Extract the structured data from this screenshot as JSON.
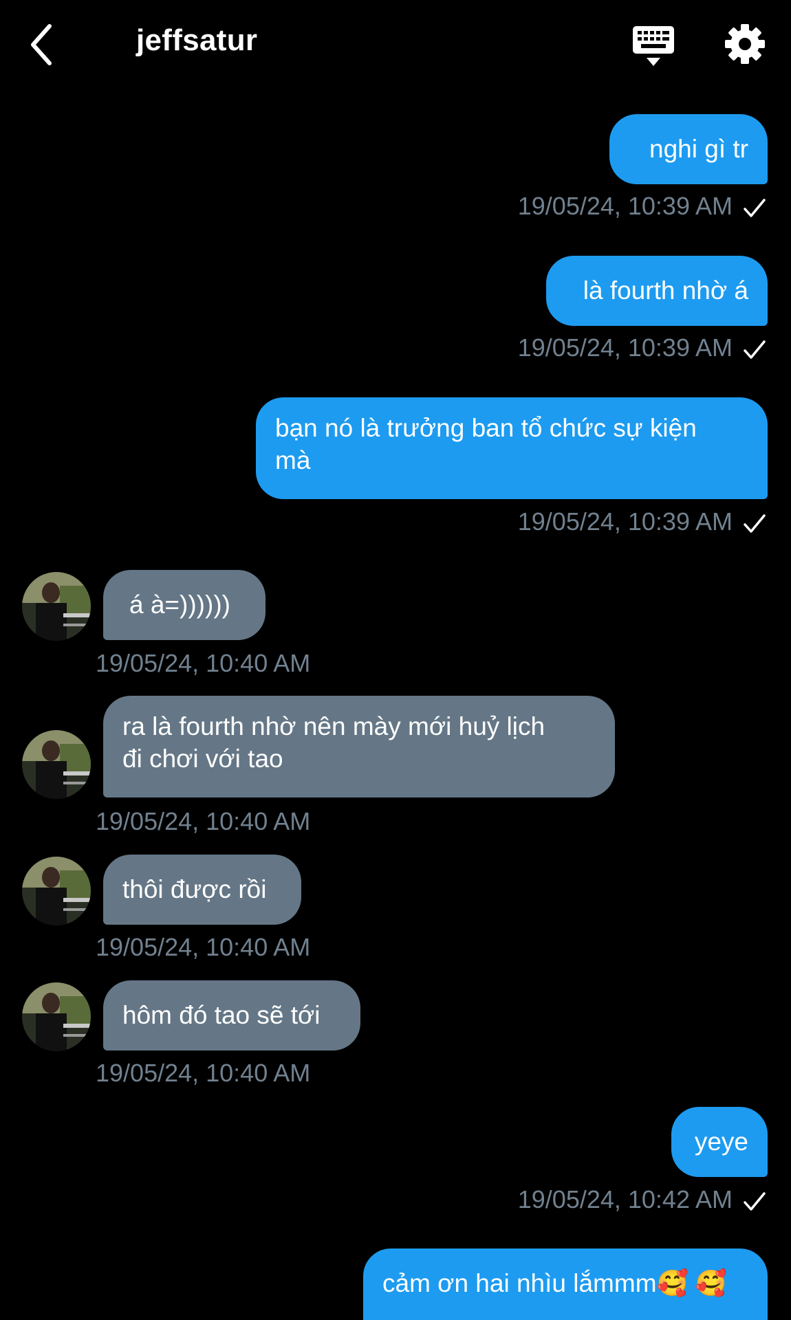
{
  "header": {
    "title": "jeffsatur"
  },
  "icons": {
    "back": "chevron-left-icon",
    "keyboard": "keyboard-icon",
    "settings": "gear-icon",
    "read_receipt": "checkmark-icon"
  },
  "colors": {
    "background": "#000000",
    "sent_bubble": "#1d9bf0",
    "received_bubble": "#657786",
    "timestamp": "#71818f",
    "text": "#ffffff"
  },
  "messages": [
    {
      "direction": "sent",
      "lines": [
        "nghi gì tr"
      ],
      "timestamp": "19/05/24, 10:39 AM"
    },
    {
      "direction": "sent",
      "lines": [
        "là fourth nhờ á"
      ],
      "timestamp": "19/05/24, 10:39 AM"
    },
    {
      "direction": "sent",
      "lines": [
        "bạn nó là trưởng ban tổ chức sự kiện",
        "mà"
      ],
      "timestamp": "19/05/24, 10:39 AM"
    },
    {
      "direction": "received",
      "lines": [
        "á à=))))))"
      ],
      "timestamp": "19/05/24, 10:40 AM"
    },
    {
      "direction": "received",
      "lines": [
        "ra là fourth nhờ nên mày mới huỷ lịch",
        "đi chơi với tao"
      ],
      "timestamp": "19/05/24, 10:40 AM"
    },
    {
      "direction": "received",
      "lines": [
        "thôi được rồi"
      ],
      "timestamp": "19/05/24, 10:40 AM"
    },
    {
      "direction": "received",
      "lines": [
        "hôm đó tao sẽ tới"
      ],
      "timestamp": "19/05/24, 10:40 AM"
    },
    {
      "direction": "sent",
      "lines": [
        "yeye"
      ],
      "timestamp": "19/05/24, 10:42 AM"
    },
    {
      "direction": "sent",
      "lines": [
        "cảm ơn hai nhìu lắmmm🥰 🥰"
      ],
      "timestamp": ""
    }
  ]
}
